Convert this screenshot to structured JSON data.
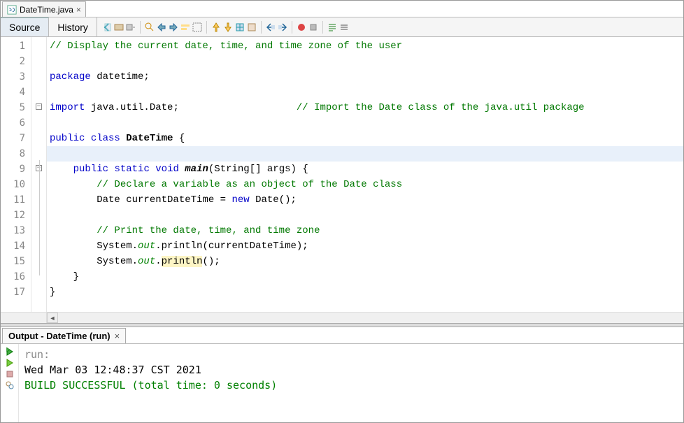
{
  "file_tab": {
    "name": "DateTime.java",
    "close": "×"
  },
  "inner_tabs": {
    "source": "Source",
    "history": "History"
  },
  "lines": [
    "1",
    "2",
    "3",
    "4",
    "5",
    "6",
    "7",
    "8",
    "9",
    "10",
    "11",
    "12",
    "13",
    "14",
    "15",
    "16",
    "17"
  ],
  "code": {
    "c1": "// Display the current date, time, and time zone of the user",
    "pkg_kw": "package",
    "pkg_rest": " datetime;",
    "imp_kw": "import",
    "imp_rest": " java.util.Date;                    ",
    "imp_cm": "// Import the Date class of the java.util package",
    "pc_public": "public",
    "pc_class": "class",
    "pc_name": "DateTime",
    "pc_brace": " {",
    "m_public": "public",
    "m_static": "static",
    "m_void": "void",
    "m_name": "main",
    "m_sig": "(String[] args) {",
    "m_c1": "// Declare a variable as an object of the Date class",
    "m_new": "new",
    "m_decl_a": "Date currentDateTime = ",
    "m_decl_b": " Date();",
    "m_c2": "// Print the date, time, and time zone",
    "p_sys": "System.",
    "p_out": "out",
    "p_pr": ".println(currentDateTime);",
    "p2_dot": ".",
    "p2_pr": "println",
    "p2_end": "();",
    "close_inner": "    }",
    "close_outer": "}"
  },
  "output": {
    "title": "Output - DateTime (run)",
    "close": "×",
    "l1": "run:",
    "l2": "Wed Mar 03 12:48:37 CST 2021",
    "l3": "",
    "l4": "BUILD SUCCESSFUL (total time: 0 seconds)"
  }
}
